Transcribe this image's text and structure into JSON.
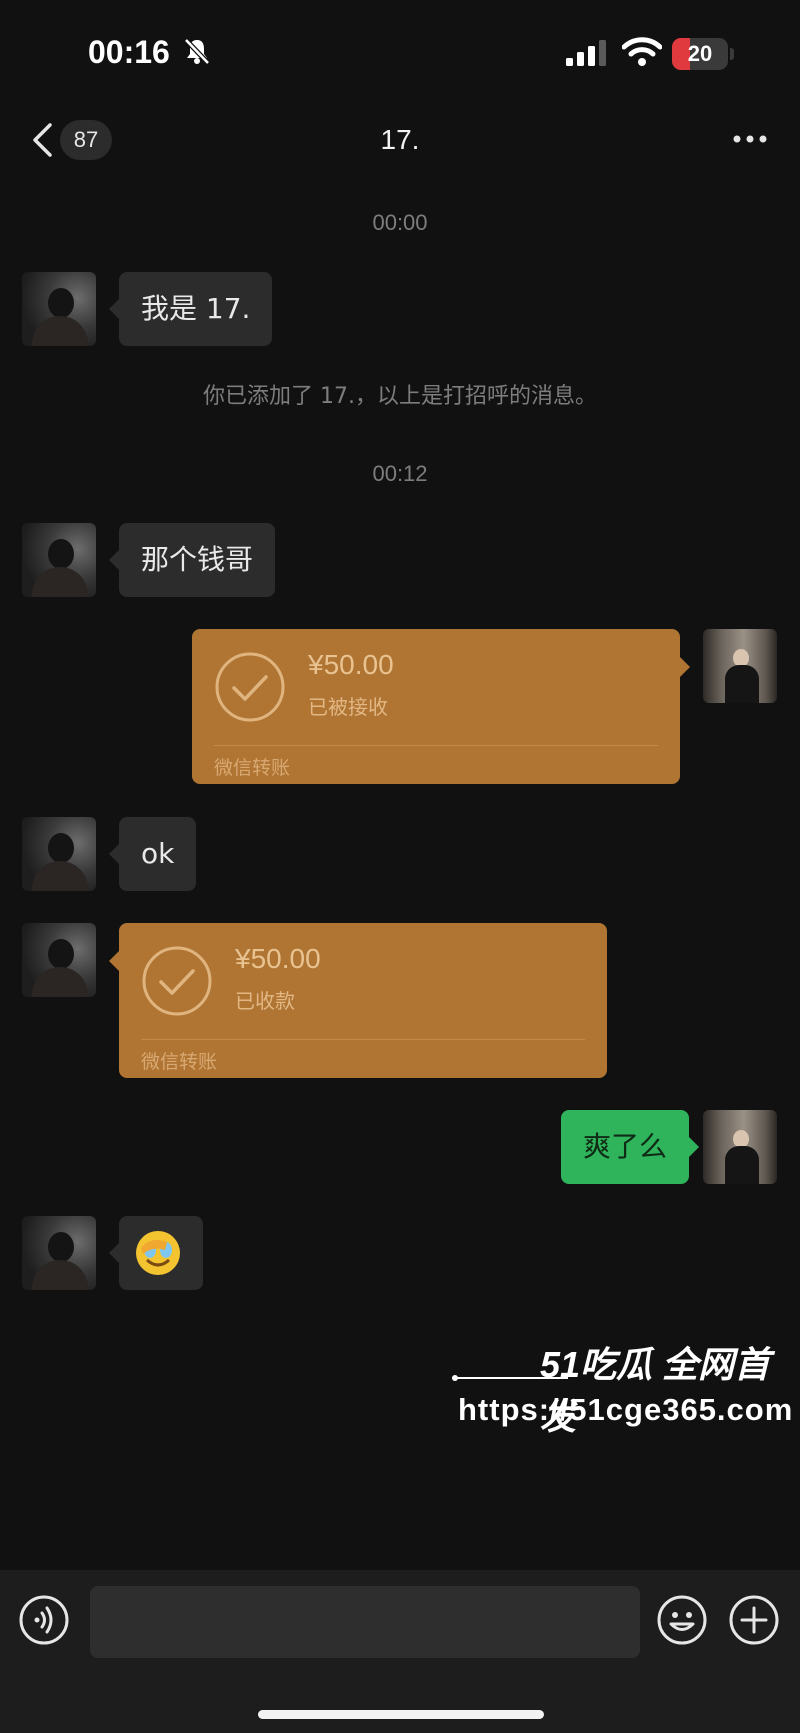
{
  "status_bar": {
    "time": "00:16",
    "battery": "20",
    "battery_color": "#e0393e"
  },
  "nav": {
    "unread_count": "87",
    "title": "17.",
    "back_icon": "chevron-left-icon",
    "more_icon": "ellipsis-icon"
  },
  "messages": [
    {
      "type": "timestamp",
      "text": "00:00"
    },
    {
      "type": "text",
      "sender": "other",
      "text": "我是 17."
    },
    {
      "type": "system",
      "text": "你已添加了 17.，以上是打招呼的消息。"
    },
    {
      "type": "timestamp",
      "text": "00:12"
    },
    {
      "type": "text",
      "sender": "other",
      "text": "那个钱哥"
    },
    {
      "type": "transfer",
      "sender": "me",
      "amount": "¥50.00",
      "status": "已被接收",
      "footer": "微信转账"
    },
    {
      "type": "text",
      "sender": "other",
      "text": "ok"
    },
    {
      "type": "transfer",
      "sender": "other",
      "amount": "¥50.00",
      "status": "已收款",
      "footer": "微信转账"
    },
    {
      "type": "text",
      "sender": "me",
      "text": "爽了么"
    },
    {
      "type": "emoji",
      "sender": "other",
      "emoji": "face-with-hand-crying-icon"
    }
  ],
  "watermark": {
    "brand": "51吃瓜 全网首发",
    "url": "https://51cge365.com"
  },
  "input_bar": {
    "voice_icon": "voice-icon",
    "emoji_icon": "smiley-icon",
    "plus_icon": "plus-circle-icon"
  },
  "colors": {
    "background": "#111111",
    "bubble_other": "#2c2c2c",
    "bubble_me": "#2fb35b",
    "transfer": "#b07533"
  }
}
